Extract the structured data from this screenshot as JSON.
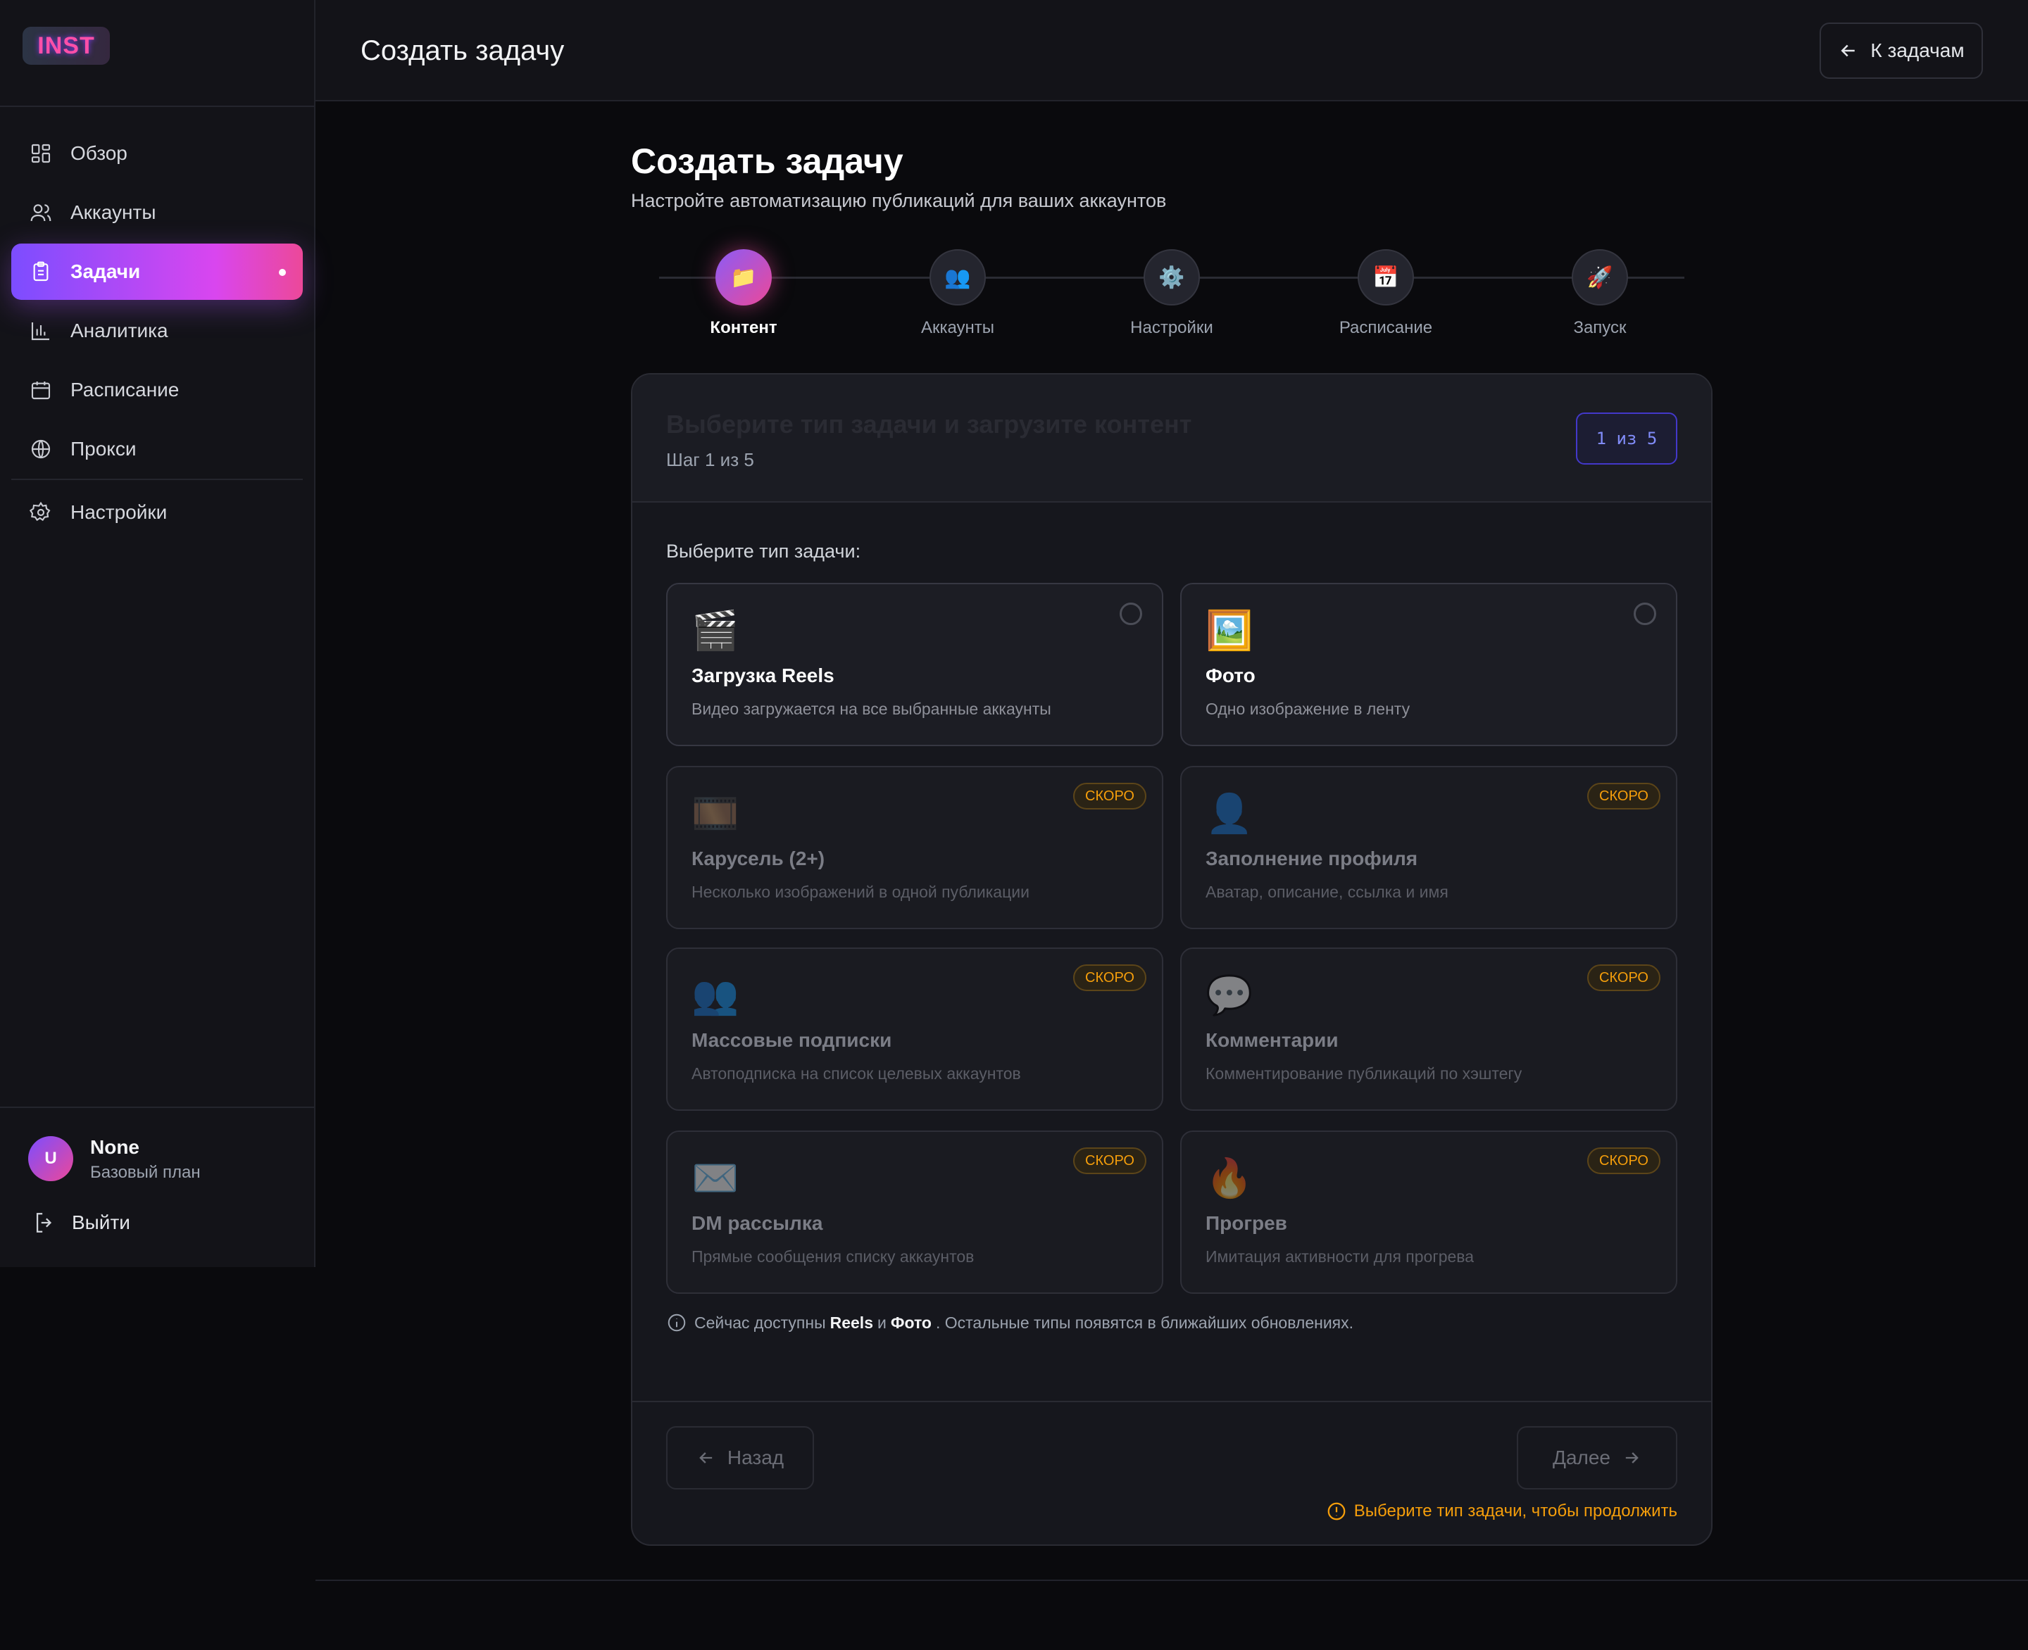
{
  "app": {
    "logo_text": "INST"
  },
  "sidebar": {
    "items": [
      {
        "label": "Обзор",
        "icon": "grid-icon"
      },
      {
        "label": "Аккаунты",
        "icon": "users-icon"
      },
      {
        "label": "Задачи",
        "icon": "clipboard-icon",
        "active": true
      },
      {
        "label": "Аналитика",
        "icon": "bar-chart-icon"
      },
      {
        "label": "Расписание",
        "icon": "calendar-icon"
      },
      {
        "label": "Прокси",
        "icon": "globe-icon"
      },
      {
        "label": "Настройки",
        "icon": "gear-icon"
      }
    ],
    "user": {
      "initial": "U",
      "name": "None",
      "plan": "Базовый план"
    },
    "logout_label": "Выйти"
  },
  "header": {
    "title": "Создать задачу",
    "back_label": "К задачам"
  },
  "page": {
    "title": "Создать задачу",
    "subtitle": "Настройте автоматизацию публикаций для ваших аккаунтов"
  },
  "stepper": {
    "steps": [
      {
        "label": "Контент",
        "emoji": "📁",
        "active": true
      },
      {
        "label": "Аккаунты",
        "emoji": "👥"
      },
      {
        "label": "Настройки",
        "emoji": "⚙️"
      },
      {
        "label": "Расписание",
        "emoji": "📅"
      },
      {
        "label": "Запуск",
        "emoji": "🚀"
      }
    ]
  },
  "card": {
    "title": "Выберите тип задачи и загрузите контент",
    "step_text": "Шаг 1 из 5",
    "step_badge": "1 из 5",
    "choose_label": "Выберите тип задачи:",
    "soon_label": "СКОРО",
    "types": [
      {
        "emoji": "🎬",
        "title": "Загрузка Reels",
        "desc": "Видео загружается на все выбранные аккаунты",
        "enabled": true
      },
      {
        "emoji": "🖼️",
        "title": "Фото",
        "desc": "Одно изображение в ленту",
        "enabled": true
      },
      {
        "emoji": "🎞️",
        "title": "Карусель (2+)",
        "desc": "Несколько изображений в одной публикации",
        "enabled": false
      },
      {
        "emoji": "👤",
        "title": "Заполнение профиля",
        "desc": "Аватар, описание, ссылка и имя",
        "enabled": false
      },
      {
        "emoji": "👥",
        "title": "Массовые подписки",
        "desc": "Автоподписка на список целевых аккаунтов",
        "enabled": false
      },
      {
        "emoji": "💬",
        "title": "Комментарии",
        "desc": "Комментирование публикаций по хэштегу",
        "enabled": false
      },
      {
        "emoji": "✉️",
        "title": "DM рассылка",
        "desc": "Прямые сообщения списку аккаунтов",
        "enabled": false
      },
      {
        "emoji": "🔥",
        "title": "Прогрев",
        "desc": "Имитация активности для прогрева",
        "enabled": false
      }
    ],
    "info": {
      "prefix": "Сейчас доступны",
      "reels": "Reels",
      "and": "и",
      "photo": "Фото",
      "suffix": ". Остальные типы появятся в ближайших обновлениях."
    },
    "back_label": "Назад",
    "next_label": "Далее",
    "warning": "Выберите тип задачи, чтобы продолжить"
  },
  "colors": {
    "accent_start": "#7c4dff",
    "accent_end": "#ec4899",
    "warning": "#f59e0b",
    "badge": "#818cf8"
  }
}
